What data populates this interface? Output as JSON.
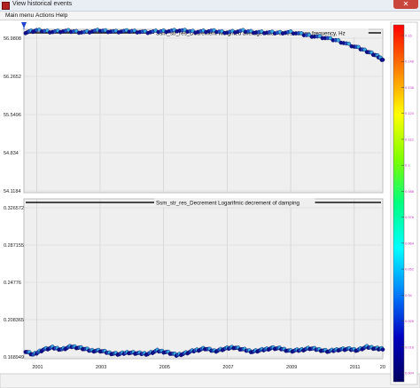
{
  "window": {
    "title": "View historical events",
    "close_glyph": "✕"
  },
  "menu": {
    "items": [
      "Main menu",
      "Actions",
      "Help"
    ]
  },
  "chart_data": [
    {
      "type": "scatter",
      "title": "Ssm_str_res_Decrement Weighted average value of resonance frequency, Hz",
      "xlabel": "",
      "ylabel": "",
      "xlim": [
        2000.6,
        2011.9
      ],
      "ylim": [
        54.1184,
        56.9808
      ],
      "ytick_labels": [
        "56.9808",
        "56.2652",
        "55.5496",
        "54.834",
        "54.1184"
      ],
      "series": [
        {
          "x": [
            2000.65,
            2001.0,
            2001.5,
            2002.0,
            2002.5,
            2003.0,
            2003.5,
            2004.0,
            2004.5,
            2005.0,
            2005.5,
            2006.0,
            2006.5,
            2007.0,
            2007.5,
            2008.0,
            2008.5,
            2009.0,
            2009.5,
            2010.0,
            2010.5,
            2011.0,
            2011.4,
            2011.7,
            2011.9
          ],
          "y": [
            56.93,
            56.96,
            56.94,
            56.95,
            56.93,
            56.96,
            56.94,
            56.95,
            56.93,
            56.95,
            56.96,
            56.94,
            56.95,
            56.93,
            56.95,
            56.93,
            56.92,
            56.93,
            56.88,
            56.84,
            56.78,
            56.68,
            56.6,
            56.52,
            56.45
          ]
        }
      ]
    },
    {
      "type": "scatter",
      "title": "Ssm_str_res_Decrement Logarifmic decrement of damping",
      "xlabel": "",
      "ylabel": "",
      "xlim": [
        2000.6,
        2011.9
      ],
      "ylim": [
        0.168949,
        0.326572
      ],
      "ytick_labels": [
        "0.326572",
        "0.287155",
        "0.24776",
        "0.208365",
        "0.168949"
      ],
      "xtick_labels": [
        "2001",
        "2003",
        "2005",
        "2007",
        "2009",
        "2011",
        "20"
      ],
      "series": [
        {
          "x": [
            2000.65,
            2000.9,
            2001.2,
            2001.5,
            2001.8,
            2002.1,
            2002.4,
            2002.7,
            2003.0,
            2003.3,
            2003.6,
            2003.9,
            2004.2,
            2004.5,
            2004.8,
            2005.1,
            2005.4,
            2005.7,
            2006.0,
            2006.3,
            2006.6,
            2006.9,
            2007.2,
            2007.5,
            2007.8,
            2008.1,
            2008.4,
            2008.7,
            2009.0,
            2009.3,
            2009.6,
            2009.9,
            2010.2,
            2010.5,
            2010.8,
            2011.1,
            2011.4,
            2011.7,
            2011.9
          ],
          "y": [
            0.1765,
            0.1728,
            0.178,
            0.1798,
            0.1782,
            0.181,
            0.1795,
            0.177,
            0.1768,
            0.1745,
            0.1735,
            0.1752,
            0.1742,
            0.1738,
            0.1768,
            0.1755,
            0.1725,
            0.1745,
            0.1772,
            0.179,
            0.1765,
            0.1785,
            0.1803,
            0.178,
            0.176,
            0.1775,
            0.1795,
            0.1788,
            0.1765,
            0.1775,
            0.1792,
            0.1778,
            0.1762,
            0.178,
            0.1785,
            0.1775,
            0.1805,
            0.1792,
            0.1782
          ]
        }
      ]
    }
  ],
  "colorbar": {
    "tick_labels": [
      "0.16",
      "0.148",
      "0.136",
      "0.124",
      "0.112",
      "0.1",
      "0.088",
      "0.076",
      "0.064",
      "0.052",
      "0.04",
      "0.028",
      "0.016",
      "0.004"
    ],
    "colors": [
      "#ff0000",
      "#ff8000",
      "#ffff00",
      "#80ff00",
      "#00ff80",
      "#00ffff",
      "#0080ff",
      "#0000c0",
      "#000060"
    ],
    "tick_color": "#cc33cc"
  },
  "marker": {
    "color": "#1a1aa0"
  }
}
